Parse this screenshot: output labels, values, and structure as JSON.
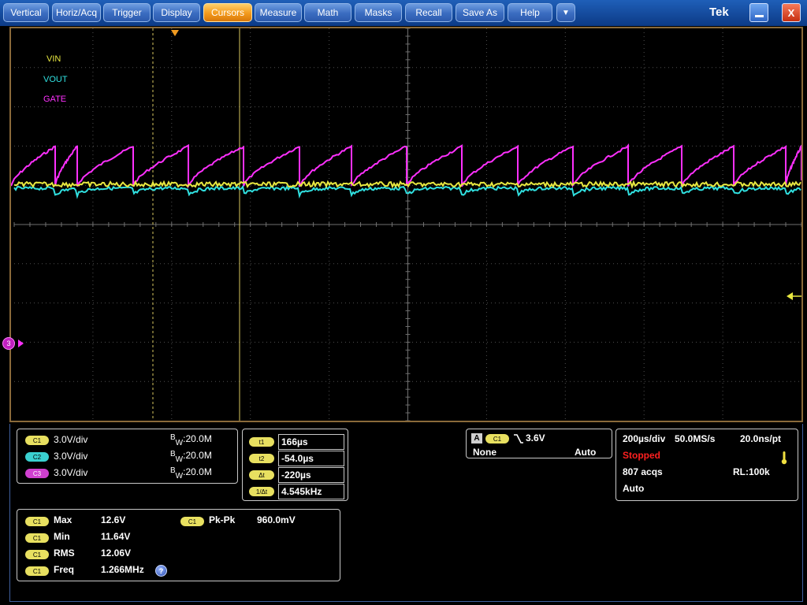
{
  "menu": [
    "Vertical",
    "Horiz/Acq",
    "Trigger",
    "Display",
    "Cursors",
    "Measure",
    "Math",
    "Masks",
    "Recall",
    "Save As",
    "Help"
  ],
  "menu_active": "Cursors",
  "menu_dropdown_icon": "triangle-down-icon",
  "brand": "Tek",
  "window_buttons": {
    "minimize_icon": "minimize-icon",
    "close_label": "X"
  },
  "colors": {
    "ch1": "#e8e840",
    "ch2": "#30e0e0",
    "ch3": "#ff30ff",
    "grid": "#505050",
    "accent": "#f09a20"
  },
  "labels": {
    "vin": "VIN",
    "vout": "VOUT",
    "gate": "GATE"
  },
  "ch3_marker": "3",
  "channels": [
    {
      "badge": "C1",
      "scale": "3.0V/div",
      "bw_b": "B",
      "bw_w": "W",
      "bw_val": ":20.0M"
    },
    {
      "badge": "C2",
      "scale": "3.0V/div",
      "bw_b": "B",
      "bw_w": "W",
      "bw_val": ":20.0M"
    },
    {
      "badge": "C3",
      "scale": "3.0V/div",
      "bw_b": "B",
      "bw_w": "W",
      "bw_val": ":20.0M"
    }
  ],
  "cursors": [
    {
      "label": "t1",
      "value": "166µs"
    },
    {
      "label": "t2",
      "value": "-54.0µs"
    },
    {
      "label": "Δt",
      "value": "-220µs"
    },
    {
      "label": "1/Δt",
      "value": "4.545kHz"
    }
  ],
  "trigger": {
    "mode_badge": "A",
    "source": "C1",
    "slope_icon": "falling-edge-icon",
    "level": "3.6V",
    "coupling": "None",
    "sweep": "Auto"
  },
  "acq": {
    "timebase": "200µs/div",
    "rate": "50.0MS/s",
    "res": "20.0ns/pt",
    "status": "Stopped",
    "acqs": "807 acqs",
    "record": "RL:100k",
    "mode": "Auto"
  },
  "measurements": [
    {
      "src": "C1",
      "name": "Max",
      "value": "12.6V"
    },
    {
      "src": "C1",
      "name": "Min",
      "value": "11.64V"
    },
    {
      "src": "C1",
      "name": "RMS",
      "value": "12.06V"
    },
    {
      "src": "C1",
      "name": "Freq",
      "value": "1.266MHz"
    },
    {
      "src": "C1",
      "name": "Pk-Pk",
      "value": "960.0mV"
    }
  ],
  "info_icon": "info-icon"
}
